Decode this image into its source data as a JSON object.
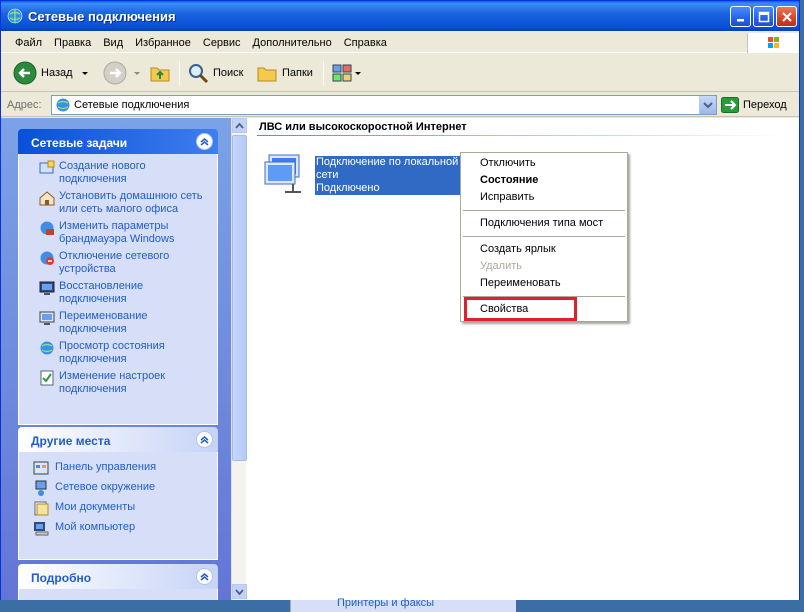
{
  "window": {
    "title": "Сетевые подключения"
  },
  "menubar": {
    "items": [
      "Файл",
      "Правка",
      "Вид",
      "Избранное",
      "Сервис",
      "Дополнительно",
      "Справка"
    ]
  },
  "toolbar": {
    "back_label": "Назад",
    "search_label": "Поиск",
    "folders_label": "Папки"
  },
  "addressbar": {
    "label": "Адрес:",
    "value": "Сетевые подключения",
    "go_label": "Переход"
  },
  "taskpane": {
    "network_tasks": {
      "title": "Сетевые задачи",
      "items": [
        "Создание нового подключения",
        "Установить домашнюю сеть или сеть малого офиса",
        "Изменить параметры брандмауэра Windows",
        "Отключение сетевого устройства",
        "Восстановление подключения",
        "Переименование подключения",
        "Просмотр состояния подключения",
        "Изменение настроек подключения"
      ]
    },
    "other_places": {
      "title": "Другие места",
      "items": [
        "Панель управления",
        "Сетевое окружение",
        "Мои документы",
        "Мой компьютер"
      ]
    },
    "details": {
      "title": "Подробно"
    }
  },
  "main": {
    "group_title": "ЛВС или высокоскоростной Интернет",
    "connection": {
      "name_line1": "Подключение по локальной",
      "name_line2": "сети",
      "status": "Подключено"
    }
  },
  "context_menu": {
    "items": {
      "disconnect": "Отключить",
      "status": "Состояние",
      "repair": "Исправить",
      "bridge": "Подключения типа мост",
      "shortcut": "Создать ярлык",
      "delete": "Удалить",
      "rename": "Переименовать",
      "properties": "Свойства"
    }
  },
  "background": {
    "ghost_item": "Принтеры и факсы"
  },
  "colors": {
    "titlebar": "#0550d8",
    "link": "#215dc6",
    "selection": "#316ac5",
    "highlight_box": "#e0202a"
  }
}
